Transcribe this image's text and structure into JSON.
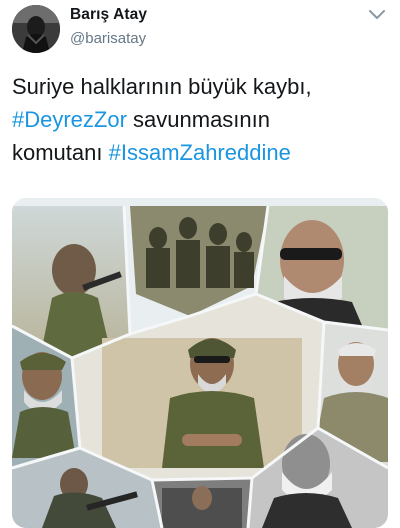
{
  "author": {
    "name": "Barış Atay",
    "handle": "@barisatay"
  },
  "tweet": {
    "line1": "Suriye halklarının büyük kaybı,",
    "hashtag1": "#DeyrezZor",
    "line2_rest": " savunmasının",
    "line3_start": "komutanı ",
    "hashtag2": "#IssamZahreddine"
  },
  "icons": {
    "avatar": "avatar-photo",
    "menu": "chevron-down-icon"
  },
  "colors": {
    "hashtag": "#1b95e0",
    "handle": "#657786",
    "text": "#14171a"
  }
}
